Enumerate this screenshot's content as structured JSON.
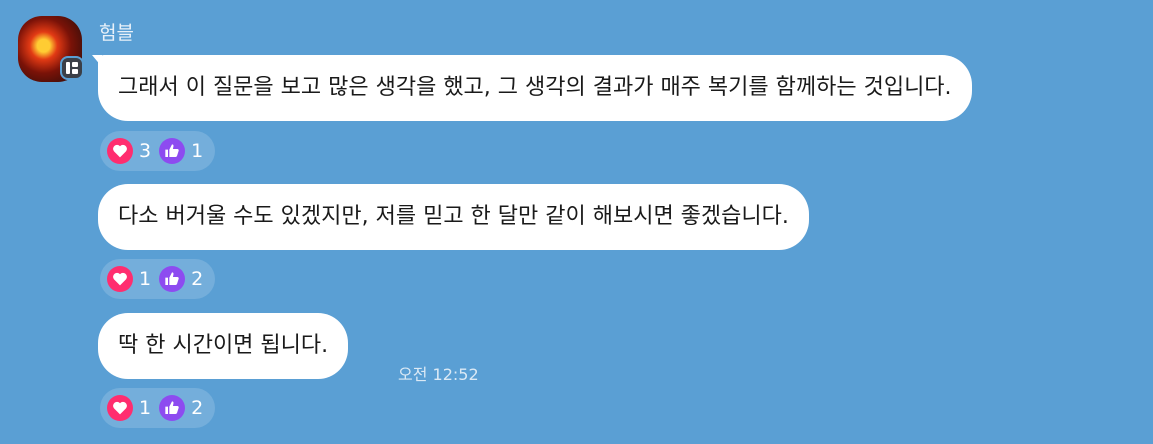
{
  "sender": {
    "name": "험블"
  },
  "messages": [
    {
      "text": "그래서 이 질문을 보고 많은 생각을 했고, 그 생각의 결과가 매주 복기를 함께하는 것입니다.",
      "reactions": {
        "heart": "3",
        "like": "1"
      }
    },
    {
      "text": "다소 버거울 수도 있겠지만, 저를 믿고 한 달만 같이 해보시면 좋겠습니다.",
      "reactions": {
        "heart": "1",
        "like": "2"
      }
    },
    {
      "text": "딱 한 시간이면 됩니다.",
      "time": "오전 12:52",
      "reactions": {
        "heart": "1",
        "like": "2"
      }
    }
  ],
  "colors": {
    "background": "#5a9fd4",
    "bubble": "#ffffff",
    "heart_reaction": "#ff2d6f",
    "like_reaction": "#8d4bf0"
  },
  "icons": [
    "heart-icon",
    "thumbs-up-icon",
    "profile-badge-icon"
  ]
}
